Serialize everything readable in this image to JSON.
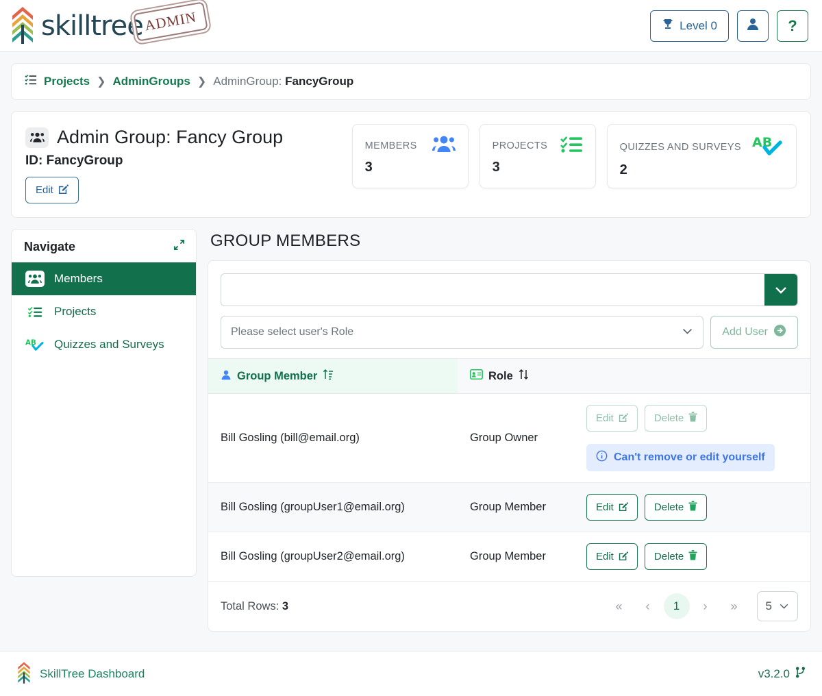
{
  "header": {
    "brand_name": "skilltree",
    "brand_stamp": "ADMIN",
    "level_label": "Level 0",
    "level_icon": "trophy-icon",
    "user_icon": "user-icon",
    "help_icon": "question-mark-icon"
  },
  "breadcrumb": {
    "icon": "list-check-icon",
    "items": [
      {
        "label": "Projects",
        "type": "link"
      },
      {
        "label": "AdminGroups",
        "type": "link"
      }
    ],
    "current_prefix": "AdminGroup: ",
    "current_value": "FancyGroup"
  },
  "page_header": {
    "icon": "users-group-icon",
    "title": "Admin Group: Fancy Group",
    "id_text": "ID: FancyGroup",
    "edit_label": "Edit",
    "edit_icon": "pencil-square-icon",
    "stats": [
      {
        "label": "MEMBERS",
        "value": "3",
        "icon": "users-icon"
      },
      {
        "label": "PROJECTS",
        "value": "3",
        "icon": "tasks-list-icon"
      },
      {
        "label": "QUIZZES AND SURVEYS",
        "value": "2",
        "icon": "ab-check-icon"
      }
    ]
  },
  "sidebar": {
    "title": "Navigate",
    "collapse_icon": "compress-arrows-icon",
    "items": [
      {
        "label": "Members",
        "icon": "users-group-icon",
        "active": true
      },
      {
        "label": "Projects",
        "icon": "tasks-list-icon",
        "active": false
      },
      {
        "label": "Quizzes and Surveys",
        "icon": "ab-check-icon",
        "active": false
      }
    ]
  },
  "main": {
    "title": "GROUP MEMBERS",
    "user_search": {
      "value": "",
      "placeholder": "",
      "caret_icon": "chevron-down-icon"
    },
    "role_select": {
      "value": "Please select user's Role",
      "caret_icon": "chevron-down-icon"
    },
    "add_user": {
      "label": "Add User",
      "icon": "arrow-circle-right-icon",
      "disabled": true
    },
    "table": {
      "columns": [
        {
          "label": "Group Member",
          "icon": "user-icon",
          "sort_icon": "sort-ascending-icon",
          "sorted": true
        },
        {
          "label": "Role",
          "icon": "id-card-icon",
          "sort_icon": "sort-icon",
          "sorted": false
        }
      ],
      "rows": [
        {
          "member": "Bill Gosling (bill@email.org)",
          "role": "Group Owner",
          "edit_label": "Edit",
          "delete_label": "Delete",
          "disabled": true,
          "notice": "Can't remove or edit yourself",
          "notice_icon": "info-circle-icon",
          "stripe": false
        },
        {
          "member": "Bill Gosling (groupUser1@email.org)",
          "role": "Group Member",
          "edit_label": "Edit",
          "delete_label": "Delete",
          "disabled": false,
          "notice": "",
          "notice_icon": "",
          "stripe": true
        },
        {
          "member": "Bill Gosling (groupUser2@email.org)",
          "role": "Group Member",
          "edit_label": "Edit",
          "delete_label": "Delete",
          "disabled": false,
          "notice": "",
          "notice_icon": "",
          "stripe": false
        }
      ]
    },
    "pagination": {
      "total_rows_label": "Total Rows:",
      "total_rows_value": "3",
      "first_icon": "double-chevron-left-icon",
      "prev_icon": "chevron-left-icon",
      "current_page": "1",
      "next_icon": "chevron-right-icon",
      "last_icon": "double-chevron-right-icon",
      "page_size": "5",
      "page_size_caret": "chevron-down-icon"
    }
  },
  "footer": {
    "logo_icon": "skilltree-logo-icon",
    "dashboard_label": "SkillTree Dashboard",
    "version": "v3.2.0",
    "version_icon": "code-branch-icon"
  },
  "colors": {
    "brand_green": "#11704c",
    "link_green": "#15794f",
    "blue": "#2a6496",
    "info_blue": "#3f75e0",
    "info_bg": "#e4edfd",
    "sorted_bg": "#edfaf3",
    "muted": "#6c757d"
  }
}
